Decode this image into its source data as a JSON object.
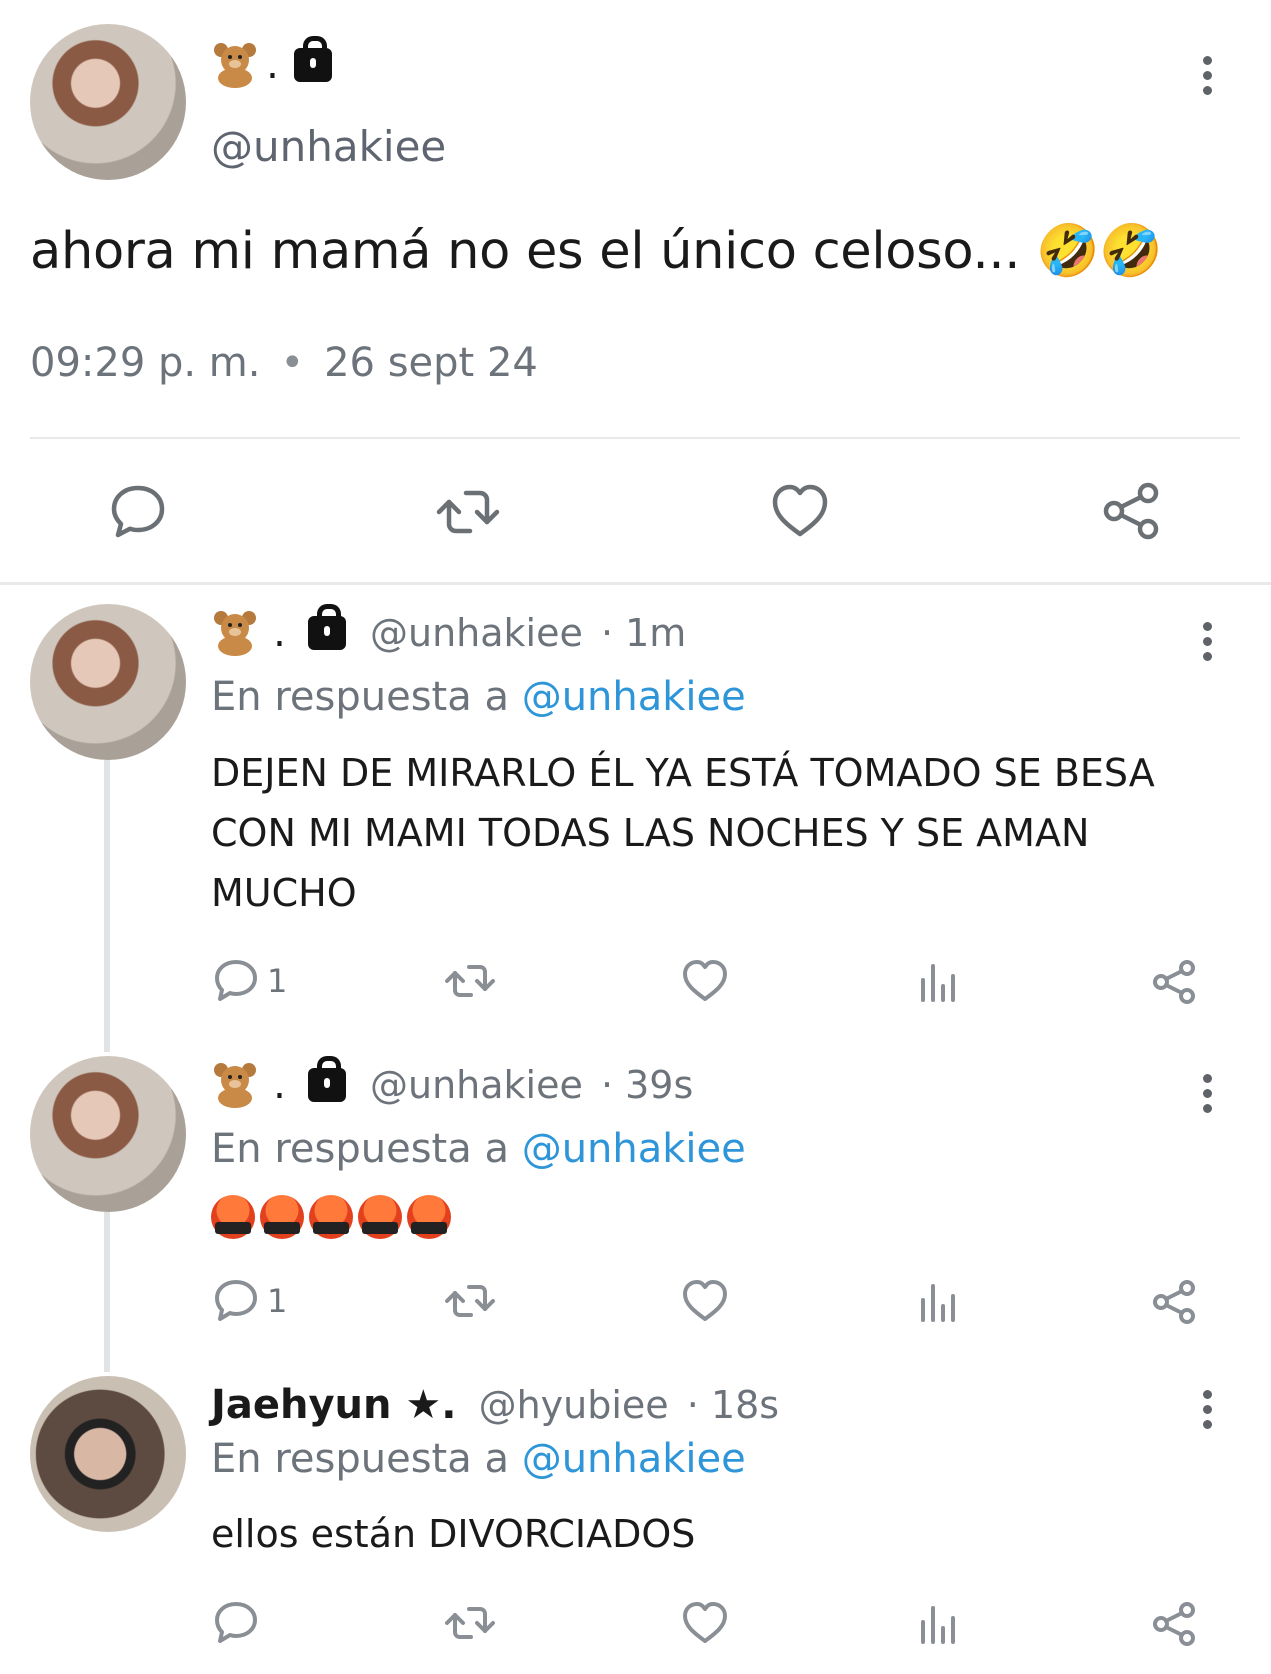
{
  "main_tweet": {
    "display_name_emoji": "🧸.",
    "handle": "@unhakiee",
    "text": "ahora mi mamá no es el único celoso... 🤣🤣",
    "time": "09:29 p. m.",
    "separator": "•",
    "date": "26 sept 24",
    "actions": [
      "reply-icon",
      "retweet-icon",
      "like-icon",
      "share-icon"
    ]
  },
  "replies": [
    {
      "name": "🧸.",
      "handle": "@unhakiee",
      "age": "· 1m",
      "replying_prefix": "En respuesta a",
      "replying_to": "@unhakiee",
      "text": "DEJEN DE MIRARLO ÉL YA ESTÁ TOMADO SE BESA CON MI MAMI TODAS LAS NOCHES Y SE AMAN MUCHO",
      "reply_count": "1"
    },
    {
      "name": "🧸.",
      "handle": "@unhakiee",
      "age": "· 39s",
      "replying_prefix": "En respuesta a",
      "replying_to": "@unhakiee",
      "text": "🤬🤬🤬🤬🤬",
      "reply_count": "1"
    },
    {
      "name": "Jaehyun ★.",
      "handle": "@hyubiee",
      "age": "· 18s",
      "replying_prefix": "En respuesta a",
      "replying_to": "@unhakiee",
      "text": "ellos están DIVORCIADOS",
      "reply_count": ""
    }
  ],
  "colors": {
    "mention": "#2e96d8",
    "muted_text": "#6d737b",
    "icon": "#8a8f96",
    "divider": "#e7e9eb"
  }
}
